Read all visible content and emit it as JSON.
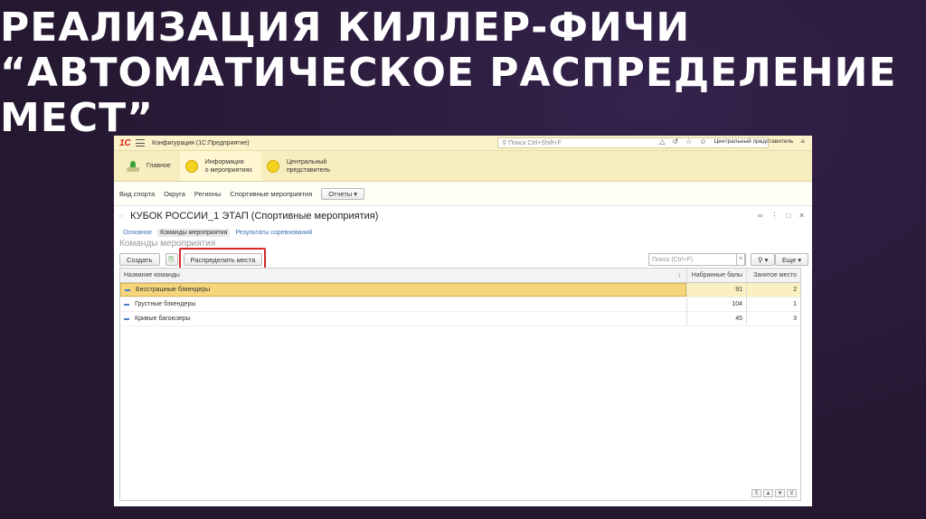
{
  "slide": {
    "title_lines": [
      "РЕАЛИЗАЦИЯ КИЛЛЕР-ФИЧИ",
      "“АВТОМАТИЧЕСКОЕ РАСПРЕДЕЛЕНИЕ",
      "МЕСТ”"
    ]
  },
  "app": {
    "logo": "1С",
    "title": "Конфигурация  (1С:Предприятие)",
    "search_placeholder": "Поиск Ctrl+Shift+F",
    "user": "Центральный представитель",
    "sections": [
      {
        "label_1": "Главное",
        "label_2": ""
      },
      {
        "label_1": "Информация",
        "label_2": "о мероприятиях"
      },
      {
        "label_1": "Центральный",
        "label_2": "представитель"
      }
    ],
    "commands": [
      "Вид спорта",
      "Округа",
      "Регионы",
      "Спортивные мероприятия"
    ],
    "reports_button": "Отчеты",
    "doc_title": "КУБОК РОССИИ_1 ЭТАП (Спортивные мероприятия)",
    "tabs": [
      "Основное",
      "Команды мероприятия",
      "Результаты соревнований"
    ],
    "group_title": "Команды мероприятия",
    "toolbar": {
      "create": "Создать",
      "distribute": "Распределить места",
      "search_placeholder": "Поиск (Ctrl+F)",
      "more": "Еще"
    },
    "table": {
      "columns": [
        "Название команды",
        "Набранные балы",
        "Занятое место"
      ],
      "rows": [
        {
          "name": "Бесстрашные бэкендеры",
          "score": "91",
          "place": "2"
        },
        {
          "name": "Грустные бэкендеры",
          "score": "104",
          "place": "1"
        },
        {
          "name": "Кривые багоюзеры",
          "score": "45",
          "place": "3"
        }
      ]
    }
  }
}
